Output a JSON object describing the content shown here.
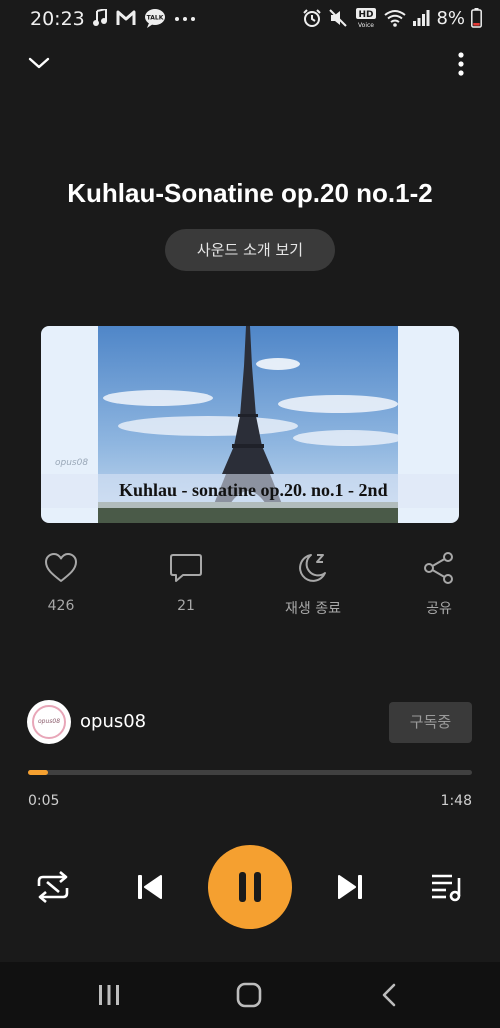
{
  "status_bar": {
    "time": "20:23",
    "left_icons": [
      "music-note-icon",
      "gmail-icon",
      "talk-icon",
      "more-dots-icon"
    ],
    "right_icons": [
      "alarm-icon",
      "mute-icon",
      "hd-voice-icon",
      "wifi-icon",
      "signal-icon",
      "battery-icon"
    ],
    "hd_label": "HD",
    "voice_label": "Voice",
    "talk_label": "TALK",
    "battery": "8%"
  },
  "player": {
    "title": "Kuhlau-Sonatine op.20 no.1-2",
    "intro_button": "사운드 소개 보기",
    "artwork": {
      "caption": "Kuhlau - sonatine op.20. no.1 - 2nd",
      "watermark": "opus08"
    },
    "actions": [
      {
        "name": "like",
        "icon": "heart-icon",
        "label": "426"
      },
      {
        "name": "comments",
        "icon": "comment-icon",
        "label": "21"
      },
      {
        "name": "sleep-timer",
        "icon": "moon-sleep-icon",
        "label": "재생 종료"
      },
      {
        "name": "share",
        "icon": "share-icon",
        "label": "공유"
      }
    ],
    "channel": {
      "name": "opus08",
      "avatar_text": "opus08",
      "subscribe_label": "구독중"
    },
    "progress": {
      "current": "0:05",
      "total": "1:48",
      "fraction": 0.046
    },
    "controls": [
      "repeat-icon",
      "previous-icon",
      "pause-icon",
      "next-icon",
      "playlist-icon"
    ]
  },
  "nav_bar": {
    "items": [
      "recent-apps-icon",
      "home-icon",
      "back-icon"
    ]
  },
  "colors": {
    "background": "#1a1a1a",
    "accent": "#f5a030",
    "button_bg": "#3a3a3a"
  }
}
